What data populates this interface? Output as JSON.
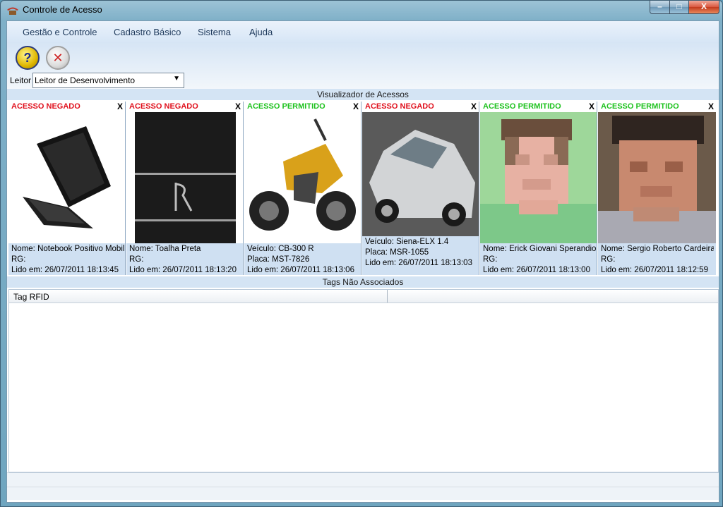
{
  "window": {
    "title": "Controle de Acesso",
    "buttons": {
      "minimize": "–",
      "maximize": "□",
      "close": "X"
    }
  },
  "menu": [
    "Gestão e Controle",
    "Cadastro Básico",
    "Sistema",
    "Ajuda"
  ],
  "toolbar": {
    "help_icon": "?",
    "exit_icon": "✕",
    "reader_label": "Leitor",
    "reader_value": "Leitor de Desenvolvimento",
    "reader_arrow": "▼"
  },
  "viewer": {
    "title": "Visualizador de Acessos",
    "cards": [
      {
        "status": "ACESSO NEGADO",
        "close": "X",
        "lines": [
          "Nome: Notebook Positivo Mobile",
          "RG:",
          "Lido em: 26/07/2011 18:13:45"
        ]
      },
      {
        "status": "ACESSO NEGADO",
        "close": "X",
        "lines": [
          "Nome: Toalha Preta",
          "RG:",
          "Lido em: 26/07/2011 18:13:20"
        ]
      },
      {
        "status": "ACESSO PERMITIDO",
        "close": "X",
        "lines": [
          "Veículo: CB-300 R",
          "Placa: MST-7826",
          "Lido em: 26/07/2011 18:13:06"
        ]
      },
      {
        "status": "ACESSO NEGADO",
        "close": "X",
        "lines": [
          "Veículo: Siena-ELX 1.4",
          "Placa: MSR-1055",
          "Lido em: 26/07/2011 18:13:03"
        ]
      },
      {
        "status": "ACESSO PERMITIDO",
        "close": "X",
        "lines": [
          "Nome: Erick Giovani Sperandio",
          "RG:",
          "Lido em: 26/07/2011 18:13:00"
        ]
      },
      {
        "status": "ACESSO PERMITIDO",
        "close": "X",
        "lines": [
          "Nome: Sergio Roberto Cardeira",
          "RG:",
          "Lido em: 26/07/2011 18:12:59"
        ]
      }
    ]
  },
  "tags": {
    "title": "Tags Não Associados",
    "columns": [
      "Tag RFID",
      ""
    ]
  },
  "colors": {
    "denied": "#e0101c",
    "allowed": "#1ec21e",
    "header_bg": "#d4e4f4"
  }
}
